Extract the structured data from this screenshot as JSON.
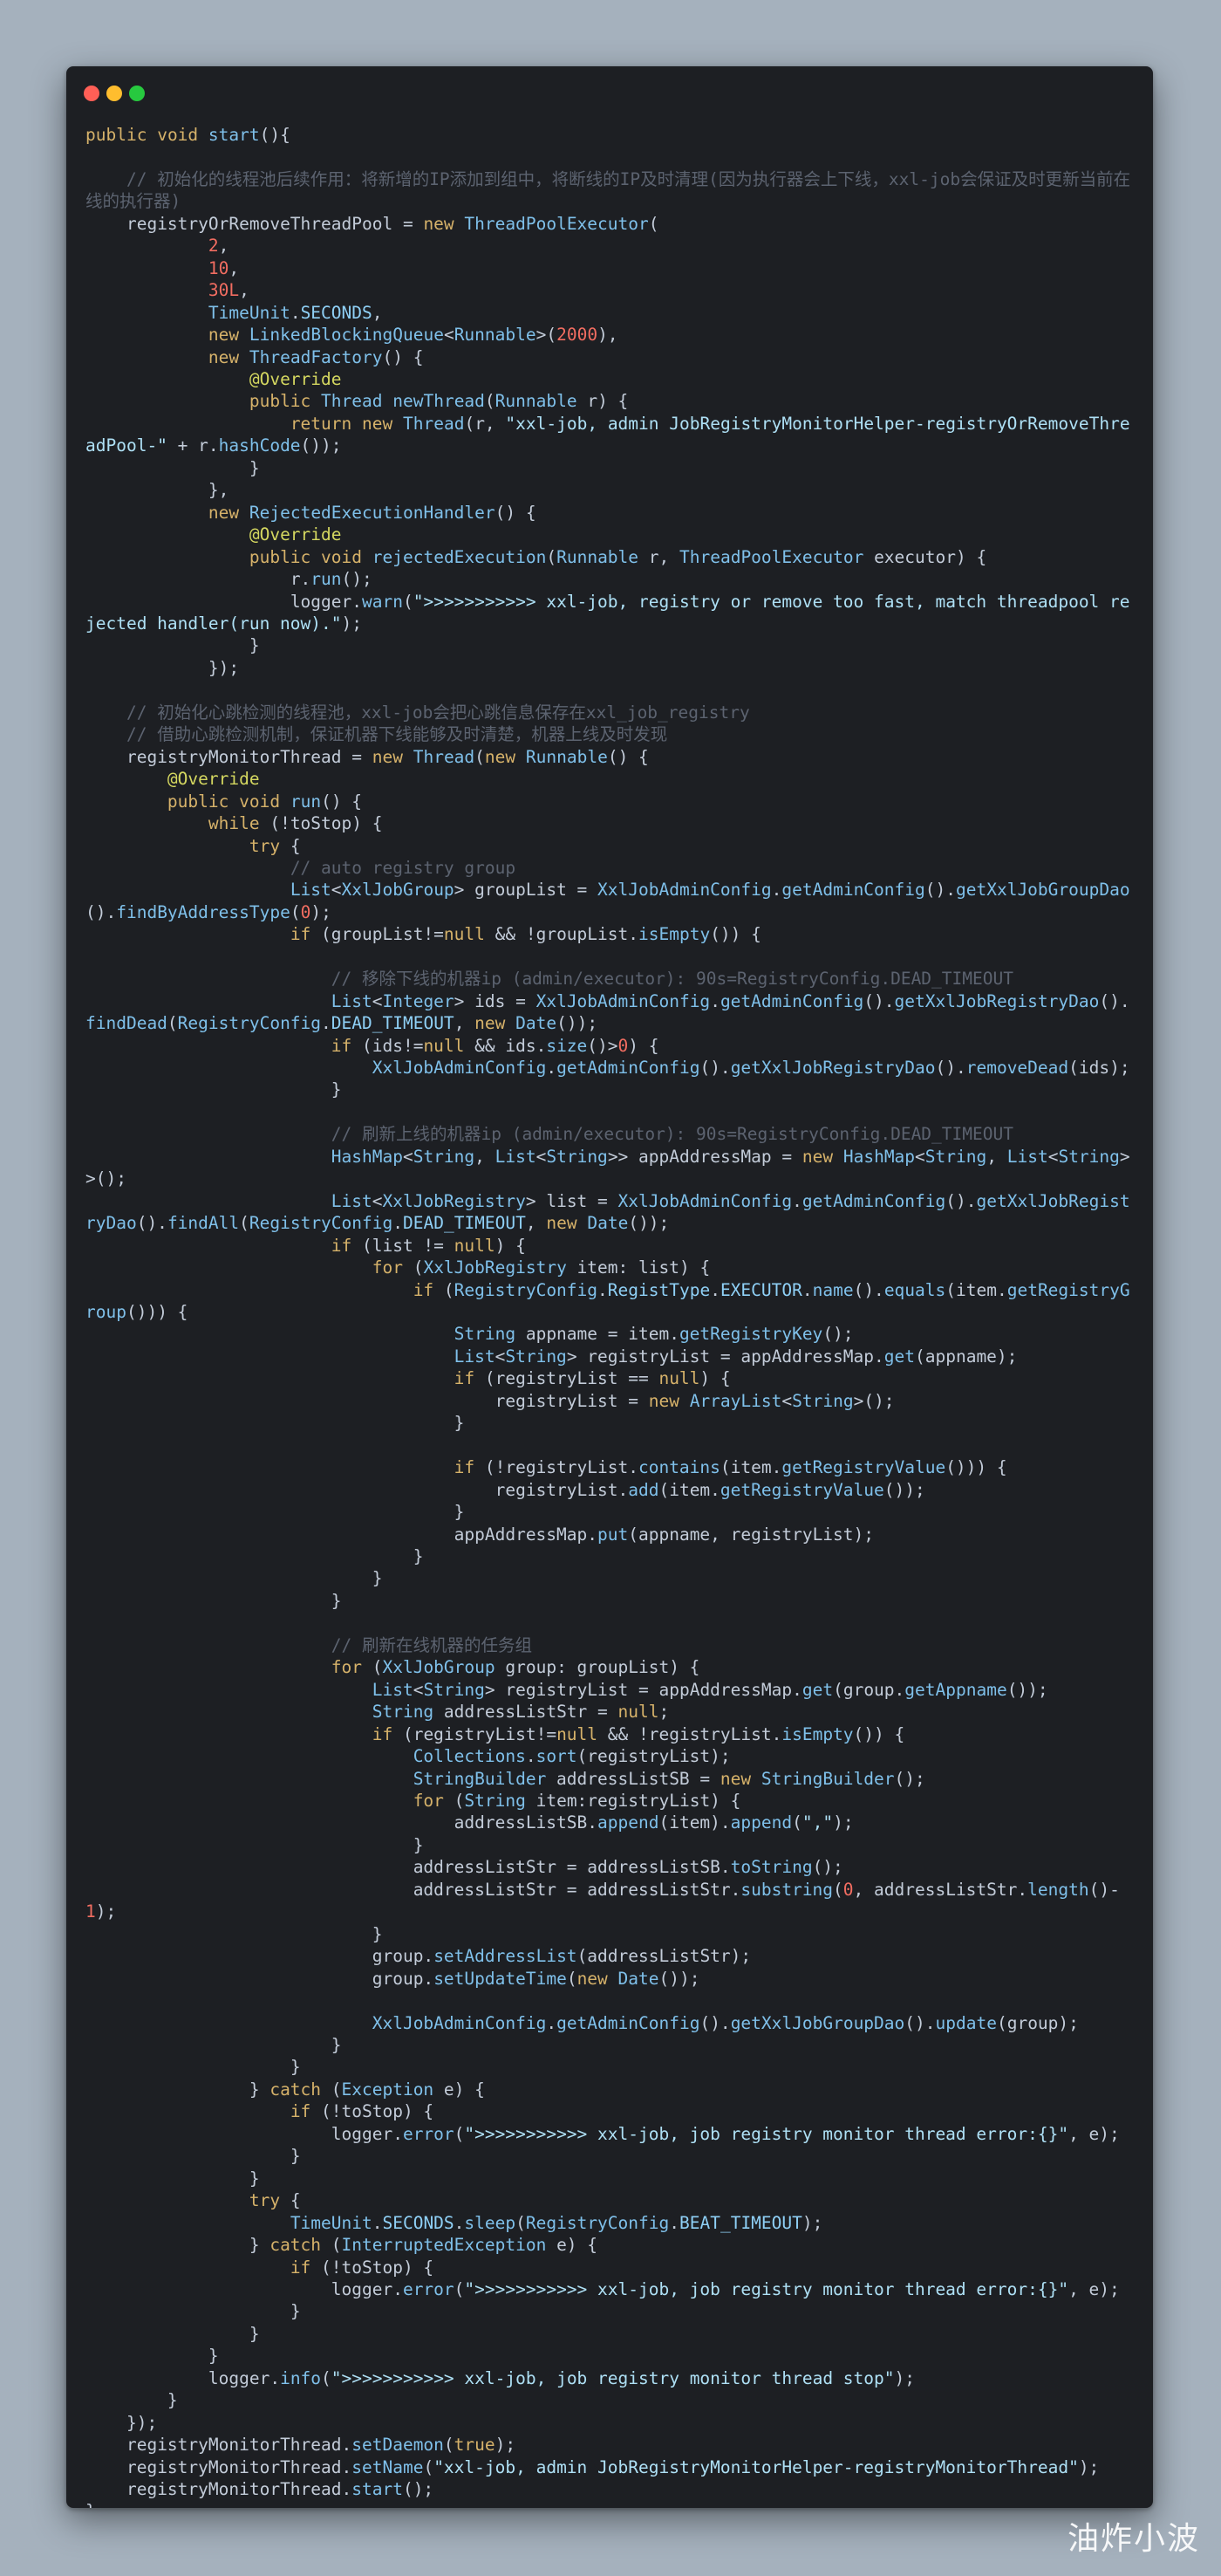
{
  "window": {
    "controls": [
      "close",
      "minimize",
      "zoom"
    ],
    "colors": {
      "close": "#ff5f56",
      "minimize": "#ffbd2e",
      "zoom": "#27c93f",
      "background": "#1d1f23",
      "page": "#a5b1bd"
    }
  },
  "code": {
    "language": "java",
    "lines": [
      "public void start(){",
      "",
      "    // 初始化的线程池后续作用：将新增的IP添加到组中，将断线的IP及时清理(因为执行器会上下线，xxl-job会保证及时更新当前在线的执行器)",
      "    registryOrRemoveThreadPool = new ThreadPoolExecutor(",
      "            2,",
      "            10,",
      "            30L,",
      "            TimeUnit.SECONDS,",
      "            new LinkedBlockingQueue<Runnable>(2000),",
      "            new ThreadFactory() {",
      "                @Override",
      "                public Thread newThread(Runnable r) {",
      "                    return new Thread(r, \"xxl-job, admin JobRegistryMonitorHelper-registryOrRemoveThreadPool-\" + r.hashCode());",
      "                }",
      "            },",
      "            new RejectedExecutionHandler() {",
      "                @Override",
      "                public void rejectedExecution(Runnable r, ThreadPoolExecutor executor) {",
      "                    r.run();",
      "                    logger.warn(\">>>>>>>>>>> xxl-job, registry or remove too fast, match threadpool rejected handler(run now).\");",
      "                }",
      "            });",
      "",
      "    // 初始化心跳检测的线程池，xxl-job会把心跳信息保存在xxl_job_registry",
      "    // 借助心跳检测机制，保证机器下线能够及时清楚，机器上线及时发现",
      "    registryMonitorThread = new Thread(new Runnable() {",
      "        @Override",
      "        public void run() {",
      "            while (!toStop) {",
      "                try {",
      "                    // auto registry group",
      "                    List<XxlJobGroup> groupList = XxlJobAdminConfig.getAdminConfig().getXxlJobGroupDao().findByAddressType(0);",
      "                    if (groupList!=null && !groupList.isEmpty()) {",
      "",
      "                        // 移除下线的机器ip (admin/executor): 90s=RegistryConfig.DEAD_TIMEOUT",
      "                        List<Integer> ids = XxlJobAdminConfig.getAdminConfig().getXxlJobRegistryDao().findDead(RegistryConfig.DEAD_TIMEOUT, new Date());",
      "                        if (ids!=null && ids.size()>0) {",
      "                            XxlJobAdminConfig.getAdminConfig().getXxlJobRegistryDao().removeDead(ids);",
      "                        }",
      "",
      "                        // 刷新上线的机器ip (admin/executor): 90s=RegistryConfig.DEAD_TIMEOUT",
      "                        HashMap<String, List<String>> appAddressMap = new HashMap<String, List<String>>();",
      "                        List<XxlJobRegistry> list = XxlJobAdminConfig.getAdminConfig().getXxlJobRegistryDao().findAll(RegistryConfig.DEAD_TIMEOUT, new Date());",
      "                        if (list != null) {",
      "                            for (XxlJobRegistry item: list) {",
      "                                if (RegistryConfig.RegistType.EXECUTOR.name().equals(item.getRegistryGroup())) {",
      "                                    String appname = item.getRegistryKey();",
      "                                    List<String> registryList = appAddressMap.get(appname);",
      "                                    if (registryList == null) {",
      "                                        registryList = new ArrayList<String>();",
      "                                    }",
      "",
      "                                    if (!registryList.contains(item.getRegistryValue())) {",
      "                                        registryList.add(item.getRegistryValue());",
      "                                    }",
      "                                    appAddressMap.put(appname, registryList);",
      "                                }",
      "                            }",
      "                        }",
      "",
      "                        // 刷新在线机器的任务组",
      "                        for (XxlJobGroup group: groupList) {",
      "                            List<String> registryList = appAddressMap.get(group.getAppname());",
      "                            String addressListStr = null;",
      "                            if (registryList!=null && !registryList.isEmpty()) {",
      "                                Collections.sort(registryList);",
      "                                StringBuilder addressListSB = new StringBuilder();",
      "                                for (String item:registryList) {",
      "                                    addressListSB.append(item).append(\",\");",
      "                                }",
      "                                addressListStr = addressListSB.toString();",
      "                                addressListStr = addressListStr.substring(0, addressListStr.length()-1);",
      "                            }",
      "                            group.setAddressList(addressListStr);",
      "                            group.setUpdateTime(new Date());",
      "",
      "                            XxlJobAdminConfig.getAdminConfig().getXxlJobGroupDao().update(group);",
      "                        }",
      "                    }",
      "                } catch (Exception e) {",
      "                    if (!toStop) {",
      "                        logger.error(\">>>>>>>>>>> xxl-job, job registry monitor thread error:{}\", e);",
      "                    }",
      "                }",
      "                try {",
      "                    TimeUnit.SECONDS.sleep(RegistryConfig.BEAT_TIMEOUT);",
      "                } catch (InterruptedException e) {",
      "                    if (!toStop) {",
      "                        logger.error(\">>>>>>>>>>> xxl-job, job registry monitor thread error:{}\", e);",
      "                    }",
      "                }",
      "            }",
      "            logger.info(\">>>>>>>>>>> xxl-job, job registry monitor thread stop\");",
      "        }",
      "    });",
      "    registryMonitorThread.setDaemon(true);",
      "    registryMonitorThread.setName(\"xxl-job, admin JobRegistryMonitorHelper-registryMonitorThread\");",
      "    registryMonitorThread.start();",
      "}"
    ]
  },
  "watermark": "油炸小波"
}
